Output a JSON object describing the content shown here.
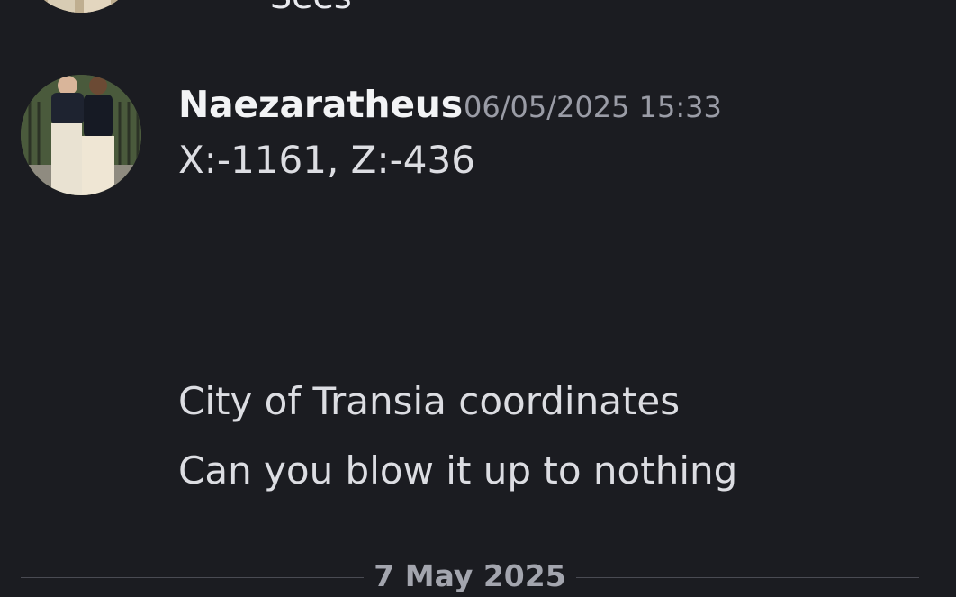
{
  "previous_message": {
    "partial_text": "Sees"
  },
  "message": {
    "author": "Naezaratheus",
    "timestamp": "06/05/2025 15:33",
    "lines": [
      "X:-1161, Z:-436",
      "City of Transia coordinates",
      "Can you blow it up to nothing"
    ]
  },
  "date_divider": {
    "label": "7 May 2025"
  },
  "colors": {
    "background": "#1b1c21",
    "author": "#f2f3f5",
    "timestamp": "#9a9ca6",
    "message_text": "#dcdde2",
    "divider": "#4a4b53"
  },
  "icons": {
    "author_avatar": "user-photo-avatar"
  }
}
